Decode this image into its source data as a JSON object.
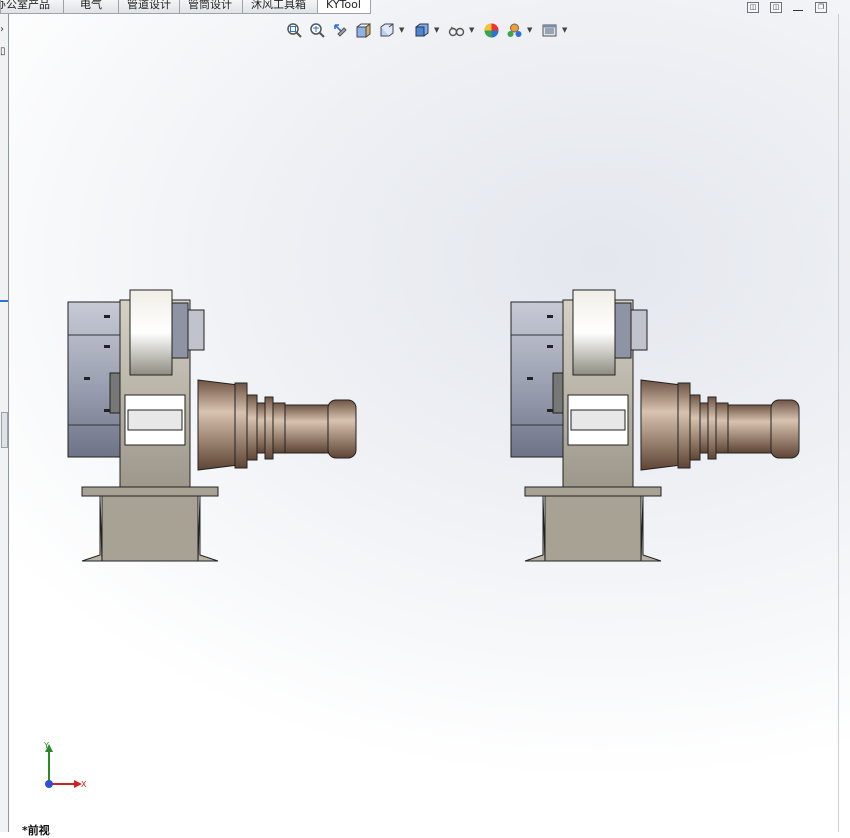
{
  "tabs": [
    {
      "label": "办公室产品"
    },
    {
      "label": "电气"
    },
    {
      "label": "管道设计"
    },
    {
      "label": "管筒设计"
    },
    {
      "label": "沐风工具箱"
    },
    {
      "label": "KYTool"
    }
  ],
  "hud_tools": [
    {
      "icon": "zoom-to-fit-icon"
    },
    {
      "icon": "zoom-to-area-icon"
    },
    {
      "icon": "previous-view-icon"
    },
    {
      "icon": "section-view-icon"
    },
    {
      "icon": "view-orientation-icon",
      "dropdown": true
    },
    {
      "icon": "display-style-icon",
      "dropdown": true
    },
    {
      "icon": "hide-show-items-icon",
      "dropdown": true
    },
    {
      "icon": "edit-appearance-icon"
    },
    {
      "icon": "apply-scene-icon",
      "dropdown": true
    },
    {
      "icon": "view-settings-icon",
      "dropdown": true
    }
  ],
  "triad": {
    "y_label": "Y",
    "x_label": "X"
  },
  "view_label": "*前视",
  "colors": {
    "base": "#a7a294",
    "blue_gray": "#9096a8",
    "copper": "#a08876"
  }
}
